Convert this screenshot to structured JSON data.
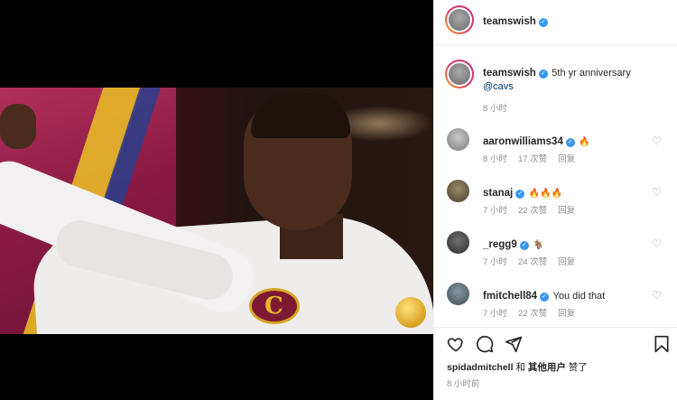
{
  "post": {
    "author": "teamswish",
    "caption": "5th yr anniversary",
    "mention": "@cavs",
    "time": "8 小时"
  },
  "comments": [
    {
      "user": "aaronwilliams34",
      "text": "🔥",
      "time": "8 小时",
      "likes": "17 次赞",
      "reply": "回复"
    },
    {
      "user": "stanaj",
      "text": "🔥🔥🔥",
      "time": "7 小时",
      "likes": "22 次赞",
      "reply": "回复"
    },
    {
      "user": "_regg9",
      "text": "🐐",
      "time": "7 小时",
      "likes": "24 次赞",
      "reply": "回复"
    },
    {
      "user": "fmitchell84",
      "text": "You did that",
      "time": "7 小时",
      "likes": "22 次赞",
      "reply": "回复"
    }
  ],
  "likes_line": {
    "user": "spidadmitchell",
    "and": "和",
    "others": "其他用户",
    "liked": "赞了"
  },
  "post_time": "8 小时前",
  "icons": [
    "heart-icon",
    "comment-icon",
    "share-icon",
    "bookmark-icon",
    "verified-icon"
  ],
  "colors": {
    "verified": "#3897f0",
    "muted": "#8e8e8e",
    "link": "#00376b"
  }
}
